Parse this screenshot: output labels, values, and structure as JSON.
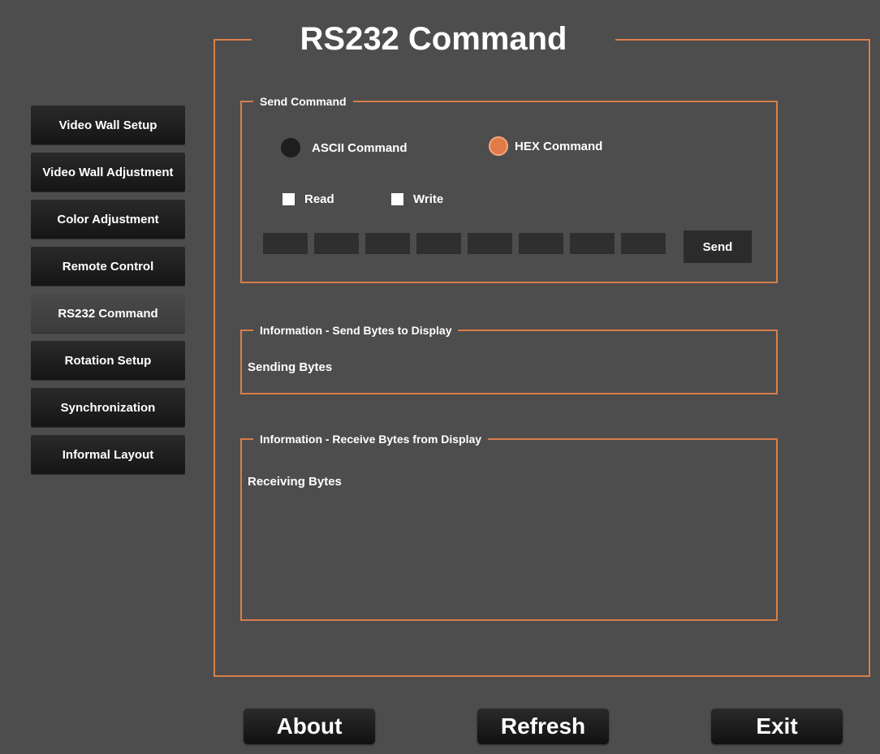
{
  "title": "RS232 Command",
  "sidebar": {
    "items": [
      {
        "label": "Video Wall Setup",
        "active": false
      },
      {
        "label": "Video Wall Adjustment",
        "active": false
      },
      {
        "label": "Color Adjustment",
        "active": false
      },
      {
        "label": "Remote Control",
        "active": false
      },
      {
        "label": "RS232 Command",
        "active": true
      },
      {
        "label": "Rotation Setup",
        "active": false
      },
      {
        "label": "Synchronization",
        "active": false
      },
      {
        "label": "Informal Layout",
        "active": false
      }
    ]
  },
  "send_command": {
    "label": "Send Command",
    "radio_ascii": "ASCII Command",
    "radio_hex": "HEX Command",
    "selected_mode": "HEX Command",
    "check_read": "Read",
    "check_write": "Write",
    "read_checked": false,
    "write_checked": false,
    "hex_values": [
      "",
      "",
      "",
      "",
      "",
      "",
      "",
      ""
    ],
    "send_label": "Send"
  },
  "info_send": {
    "label": "Information - Send Bytes to Display",
    "text": "Sending Bytes"
  },
  "info_receive": {
    "label": "Information - Receive Bytes from Display",
    "text": "Receiving Bytes"
  },
  "buttons": {
    "about": "About",
    "refresh": "Refresh",
    "exit": "Exit"
  },
  "colors": {
    "background": "#4d4d4d",
    "accent": "#d97d4c",
    "button": "#1a1a1a"
  }
}
